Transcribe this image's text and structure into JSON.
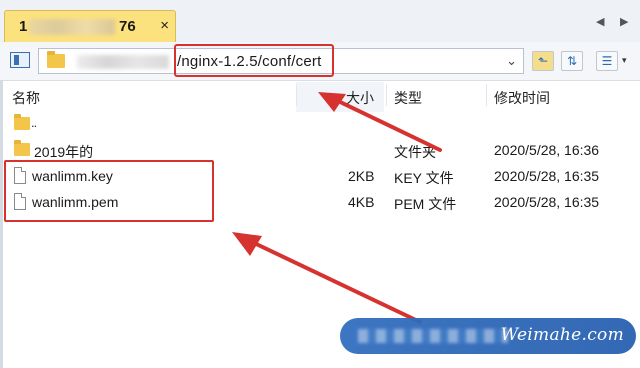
{
  "tab": {
    "prefix": "1",
    "suffix": "76",
    "close": "×"
  },
  "tab_nav": {
    "prev": "◀",
    "next": "▶"
  },
  "address": {
    "path": "/nginx-1.2.5/conf/cert",
    "dropdown": "⌄"
  },
  "toolbar": {
    "up": "⬑",
    "sync": "⇅",
    "view": "☰",
    "view_arrow": "▾"
  },
  "columns": {
    "name": "名称",
    "size": "大小",
    "type": "类型",
    "modified": "修改时间"
  },
  "rows": [
    {
      "name": "..",
      "size": "",
      "type": "",
      "modified": "",
      "icon": "parent-folder-icon"
    },
    {
      "name": "2019年的",
      "size": "",
      "type": "文件夹",
      "modified": "2020/5/28, 16:36",
      "icon": "folder-icon"
    },
    {
      "name": "wanlimm.key",
      "size": "2KB",
      "type": "KEY 文件",
      "modified": "2020/5/28, 16:35",
      "icon": "file-icon"
    },
    {
      "name": "wanlimm.pem",
      "size": "4KB",
      "type": "PEM 文件",
      "modified": "2020/5/28, 16:35",
      "icon": "file-icon"
    }
  ],
  "watermark": {
    "text": "Weimahe.com"
  },
  "annotation_color": "#d6322f"
}
